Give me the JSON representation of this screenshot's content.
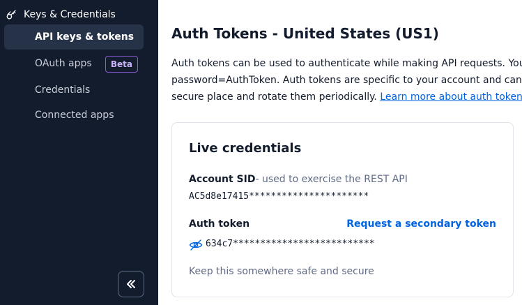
{
  "sidebar": {
    "section_title": "Keys & Credentials",
    "items": [
      {
        "label": "API keys & tokens",
        "active": true
      },
      {
        "label": "OAuth apps",
        "badge": "Beta"
      },
      {
        "label": "Credentials"
      },
      {
        "label": "Connected apps"
      }
    ],
    "collapse_icon": "double-chevron-left-icon"
  },
  "main": {
    "title": "Auth Tokens - United States (US1)",
    "description": {
      "line1": "Auth tokens can be used to authenticate while making API requests. You will",
      "line2": "password=AuthToken. Auth tokens are specific to your account and can be us",
      "line3_prefix": "secure place and rotate them periodically. ",
      "link_text": "Learn more about auth tokens."
    },
    "card": {
      "title": "Live credentials",
      "account_sid_label": "Account SID",
      "account_sid_help": "- used to exercise the REST API",
      "account_sid_value": "AC5d8e17415**********************",
      "auth_token_label": "Auth token",
      "secondary_token_link": "Request a secondary token",
      "auth_token_value": "634c7**************************",
      "footnote": "Keep this somewhere safe and secure"
    }
  },
  "colors": {
    "sidebar_bg": "#121c2d",
    "active_bg": "#263248",
    "link": "#0263e0",
    "badge": "#8c5bd8"
  }
}
